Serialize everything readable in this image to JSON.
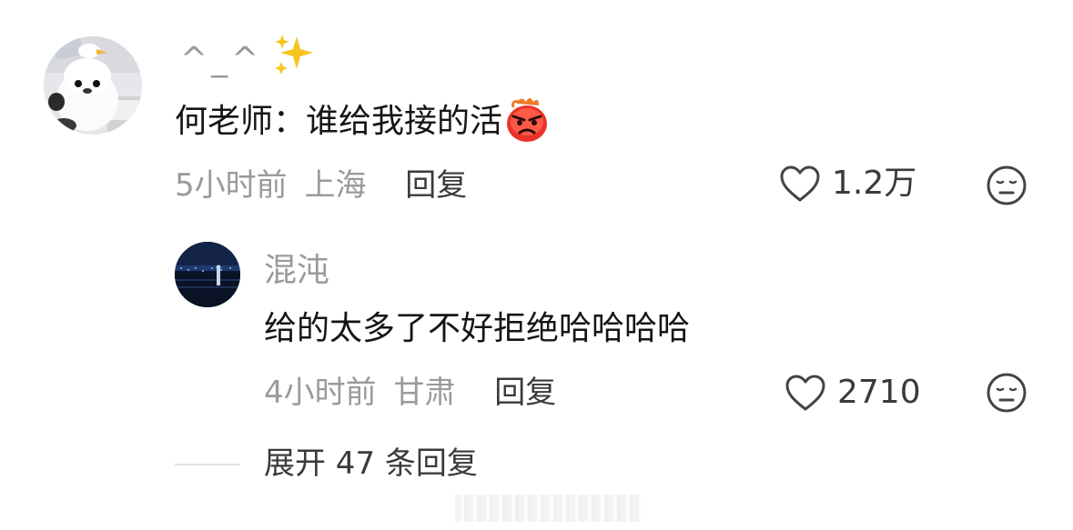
{
  "comment": {
    "username": "^_^",
    "avatar_icon": "plush-duck-avatar",
    "username_decoration_icon": "sparkles-icon",
    "text": "何老师：谁给我接的活",
    "text_emoji_icon": "angry-face-emoji",
    "time": "5小时前",
    "location": "上海",
    "reply_label": "回复",
    "like_count": "1.2万",
    "like_icon": "heart-outline-icon",
    "reaction_icon": "expressionless-face-icon"
  },
  "reply": {
    "username": "混沌",
    "avatar_icon": "night-city-avatar",
    "text": "给的太多了不好拒绝哈哈哈哈",
    "time": "4小时前",
    "location": "甘肃",
    "reply_label": "回复",
    "like_count": "2710",
    "like_icon": "heart-outline-icon",
    "reaction_icon": "expressionless-face-icon"
  },
  "expand": {
    "label": "展开 47 条回复"
  },
  "colors": {
    "meta_gray": "#9a9a9a",
    "text_dark": "#151515",
    "action_dark": "#3a3a3a"
  }
}
